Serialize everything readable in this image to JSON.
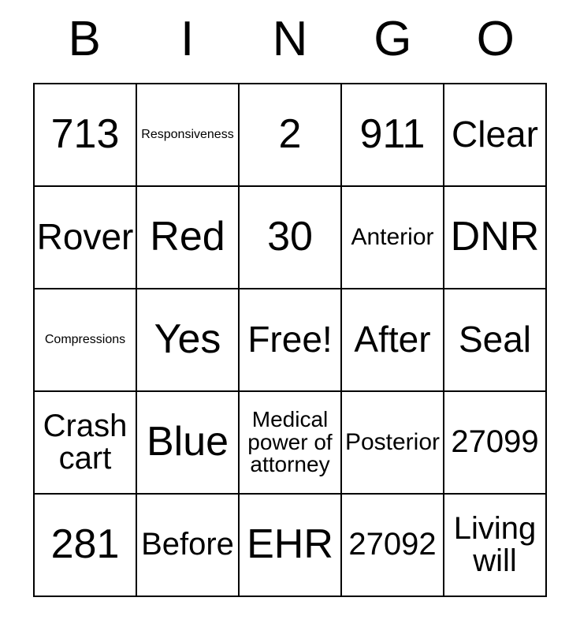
{
  "card": {
    "header_letters": [
      "B",
      "I",
      "N",
      "G",
      "O"
    ],
    "rows": [
      [
        {
          "text": "713",
          "size": "fs-xl"
        },
        {
          "text": "Responsiveness",
          "size": "fs-xxs"
        },
        {
          "text": "2",
          "size": "fs-xl"
        },
        {
          "text": "911",
          "size": "fs-xl"
        },
        {
          "text": "Clear",
          "size": "fs-lg"
        }
      ],
      [
        {
          "text": "Rover",
          "size": "fs-lg"
        },
        {
          "text": "Red",
          "size": "fs-xl"
        },
        {
          "text": "30",
          "size": "fs-xl"
        },
        {
          "text": "Anterior",
          "size": "fs-sm"
        },
        {
          "text": "DNR",
          "size": "fs-xl"
        }
      ],
      [
        {
          "text": "Compressions",
          "size": "fs-xxs"
        },
        {
          "text": "Yes",
          "size": "fs-xl"
        },
        {
          "text": "Free!",
          "size": "fs-lg"
        },
        {
          "text": "After",
          "size": "fs-lg"
        },
        {
          "text": "Seal",
          "size": "fs-lg"
        }
      ],
      [
        {
          "text": "Crash cart",
          "size": "fs-md"
        },
        {
          "text": "Blue",
          "size": "fs-xl"
        },
        {
          "text": "Medical power of attorney",
          "size": "fs-xs"
        },
        {
          "text": "Posterior",
          "size": "fs-sm"
        },
        {
          "text": "27099",
          "size": "fs-md"
        }
      ],
      [
        {
          "text": "281",
          "size": "fs-xl"
        },
        {
          "text": "Before",
          "size": "fs-md"
        },
        {
          "text": "EHR",
          "size": "fs-xl"
        },
        {
          "text": "27092",
          "size": "fs-md"
        },
        {
          "text": "Living will",
          "size": "fs-md"
        }
      ]
    ]
  },
  "colors": {
    "border": "#000000",
    "background": "#ffffff",
    "text": "#000000"
  }
}
